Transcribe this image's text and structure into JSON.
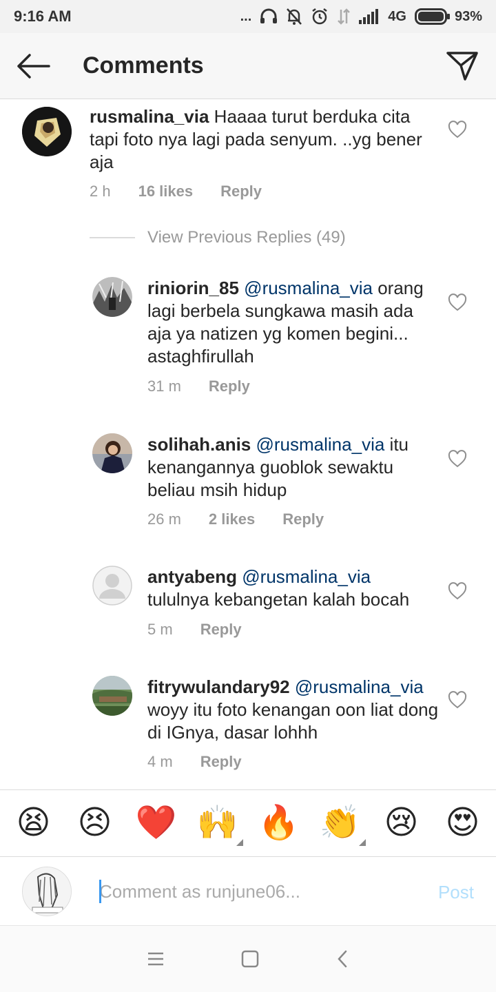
{
  "status_bar": {
    "time": "9:16 AM",
    "dots": "...",
    "network": "4G",
    "battery": "93%"
  },
  "header": {
    "title": "Comments",
    "back_icon": "arrow-left-icon",
    "send_icon": "paper-plane-icon"
  },
  "main_comment": {
    "username": "rusmalina_via",
    "text": "Haaaa turut berduka cita tapi foto nya lagi pada senyum. ..yg bener aja",
    "time": "2 h",
    "likes": "16 likes",
    "reply_label": "Reply"
  },
  "view_previous": "View Previous Replies (49)",
  "replies": [
    {
      "username": "riniorin_85",
      "mention": "@rusmalina_via",
      "text": "orang lagi berbela sungkawa masih ada aja ya natizen yg komen begini... astaghfirullah",
      "time": "31 m",
      "likes": "",
      "reply_label": "Reply"
    },
    {
      "username": "solihah.anis",
      "mention": "@rusmalina_via",
      "text": "itu kenangannya guoblok sewaktu beliau msih hidup",
      "time": "26 m",
      "likes": "2 likes",
      "reply_label": "Reply"
    },
    {
      "username": "antyabeng",
      "mention": "@rusmalina_via",
      "text": "tululnya kebangetan kalah bocah",
      "time": "5 m",
      "likes": "",
      "reply_label": "Reply"
    },
    {
      "username": "fitrywulandary92",
      "mention": "@rusmalina_via",
      "text": "woyy itu foto kenangan oon liat dong di IGnya, dasar lohhh",
      "time": "4 m",
      "likes": "",
      "reply_label": "Reply"
    }
  ],
  "emoji_bar": [
    "😫",
    "😣",
    "❤️",
    "🙌",
    "🔥",
    "👏",
    "😢",
    "😍"
  ],
  "composer": {
    "placeholder": "Comment as runjune06...",
    "post_label": "Post"
  },
  "colors": {
    "mention": "#003569",
    "post_disabled": "#b2dffc",
    "caret": "#3897f0"
  }
}
